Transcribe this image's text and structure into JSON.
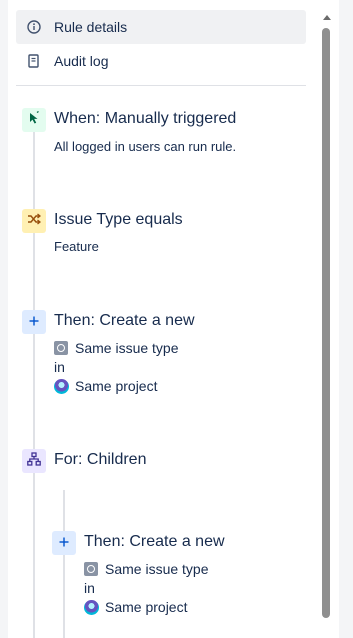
{
  "nav": {
    "items": [
      {
        "label": "Rule details",
        "icon": "info-icon",
        "active": true
      },
      {
        "label": "Audit log",
        "icon": "document-icon",
        "active": false
      }
    ]
  },
  "flow": {
    "trigger": {
      "title": "When: Manually triggered",
      "subtitle": "All logged in users can run rule.",
      "icon": "cursor-click-icon",
      "color": "#36b37e",
      "bg": "#e3fcef"
    },
    "condition": {
      "title": "Issue Type equals",
      "subtitle": "Feature",
      "icon": "shuffle-icon",
      "color": "#ff8b00",
      "bg": "#fff0b3"
    },
    "action1": {
      "title": "Then: Create a new",
      "issue_type": "Same issue type",
      "in": "in",
      "project": "Same project",
      "icon": "plus-icon",
      "color": "#0052cc",
      "bg": "#deebff"
    },
    "branch": {
      "title": "For: Children",
      "icon": "hierarchy-icon",
      "color": "#6554c0",
      "bg": "#eae6ff"
    },
    "action2": {
      "title": "Then: Create a new",
      "issue_type": "Same issue type",
      "in": "in",
      "project": "Same project",
      "icon": "plus-icon",
      "color": "#0052cc",
      "bg": "#deebff"
    }
  }
}
